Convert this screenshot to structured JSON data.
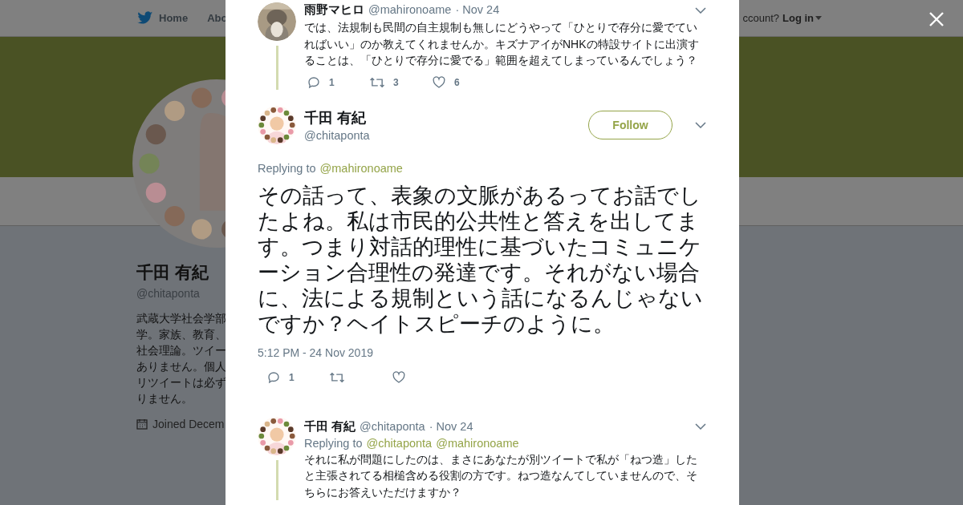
{
  "nav": {
    "items": [
      {
        "label": "Home",
        "kind": "home"
      },
      {
        "label": "Abo",
        "kind": "plain"
      }
    ],
    "account_prompt": "ccount?",
    "login": "Log in"
  },
  "profile": {
    "name": "千田 有紀",
    "handle": "@chitaponta",
    "bio_lines": [
      "武蔵大学社会学部",
      "学。家族、教育、",
      "社会理論。ツイー",
      "ありません。個人",
      "リツイートは必ず",
      "りません。"
    ],
    "joined": "Joined Decem"
  },
  "thread": [
    {
      "name": "雨野マヒロ",
      "handle": "@mahironoame",
      "date": "· Nov 24",
      "text": "では、法規制も民間の自主規制も無しにどうやって「ひとりで存分に愛でていればいい」のか教えてくれませんか。キズナアイがNHKの特設サイトに出演することは、「ひとりで存分に愛でる」範囲を超えてしまっているんでしょう？",
      "replies": "1",
      "retweets": "3",
      "likes": "6"
    }
  ],
  "focus": {
    "name": "千田 有紀",
    "handle": "@chitaponta",
    "follow": "Follow",
    "replying_label": "Replying to",
    "replying_to": [
      "@mahironoame"
    ],
    "text": "その話って、表象の文脈があるってお話でしたよね。私は市民的公共性と答えを出してます。つまり対話的理性に基づいたコミュニケーション合理性の発達です。それがない場合に、法による規制という話になるんじゃないですか？ヘイトスピーチのように。",
    "timestamp": "5:12 PM - 24 Nov 2019",
    "replies": "1"
  },
  "replies": [
    {
      "name": "千田 有紀",
      "handle": "@chitaponta",
      "date": "· Nov 24",
      "replying_label": "Replying to",
      "replying_to": [
        "@chitaponta",
        "@mahironoame"
      ],
      "text": "それに私が問題にしたのは、まさにあなたが別ツイートで私が「ねつ造」したと主張されてる相槌含める役割の方です。ねつ造なんてしていませんので、そちらにお答えいただけますか？"
    }
  ]
}
